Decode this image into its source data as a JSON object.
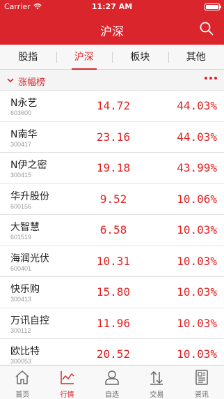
{
  "status_bar": {
    "carrier": "Carrier",
    "time": "11:27 AM",
    "wifi_icon": "wifi-icon",
    "battery_icon": "battery-icon"
  },
  "nav": {
    "title": "沪深",
    "search_icon": "search-icon"
  },
  "tabs": [
    {
      "label": "股指",
      "active": false
    },
    {
      "label": "沪深",
      "active": true
    },
    {
      "label": "板块",
      "active": false
    },
    {
      "label": "其他",
      "active": false
    }
  ],
  "section": {
    "label": "涨幅榜",
    "collapse_icon": "chevron-down-icon",
    "more_icon": "more-dots-icon"
  },
  "stocks": [
    {
      "name": "N永艺",
      "code": "603600",
      "price": "14.72",
      "change": "44.03%"
    },
    {
      "name": "N南华",
      "code": "300417",
      "price": "23.16",
      "change": "44.03%"
    },
    {
      "name": "N伊之密",
      "code": "300415",
      "price": "19.18",
      "change": "43.99%"
    },
    {
      "name": "华升股份",
      "code": "600156",
      "price": "9.52",
      "change": "10.06%"
    },
    {
      "name": "大智慧",
      "code": "601519",
      "price": "6.58",
      "change": "10.03%"
    },
    {
      "name": "海润光伏",
      "code": "600401",
      "price": "10.31",
      "change": "10.03%"
    },
    {
      "name": "快乐购",
      "code": "300413",
      "price": "15.80",
      "change": "10.03%"
    },
    {
      "name": "万讯自控",
      "code": "300112",
      "price": "11.96",
      "change": "10.03%"
    },
    {
      "name": "欧比特",
      "code": "300053",
      "price": "20.52",
      "change": "10.03%"
    }
  ],
  "tab_bar": [
    {
      "label": "首页",
      "icon": "home-icon",
      "active": false
    },
    {
      "label": "行情",
      "icon": "market-chart-icon",
      "active": true
    },
    {
      "label": "自选",
      "icon": "person-icon",
      "active": false
    },
    {
      "label": "交易",
      "icon": "trade-arrows-icon",
      "active": false
    },
    {
      "label": "资讯",
      "icon": "news-icon",
      "active": false
    }
  ],
  "colors": {
    "brand_red": "#d9252b",
    "rise_red": "#e02020"
  }
}
